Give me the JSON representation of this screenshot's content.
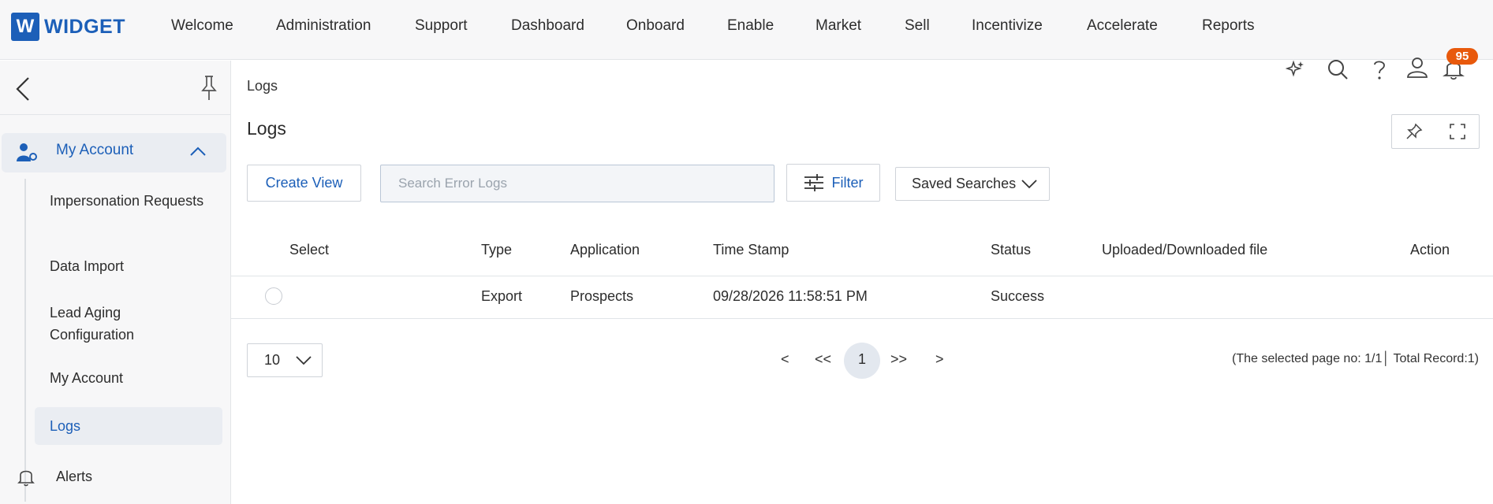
{
  "brand": {
    "logo_letter": "W",
    "name": "WIDGET",
    "color": "#1c5fb8"
  },
  "topnav": [
    "Welcome",
    "Administration",
    "Support",
    "Dashboard",
    "Onboard",
    "Enable",
    "Market",
    "Sell",
    "Incentivize",
    "Accelerate",
    "Reports"
  ],
  "notifications": {
    "count": "95",
    "badge_color": "#e8590c"
  },
  "sidebar": {
    "group_label": "My Account",
    "items": [
      {
        "label": "Impersonation Requests"
      },
      {
        "label": "Data Import"
      },
      {
        "label": "Lead Aging Configuration"
      },
      {
        "label": "My Account"
      },
      {
        "label": "Logs"
      }
    ],
    "alerts_label": "Alerts"
  },
  "breadcrumb": "Logs",
  "page_title": "Logs",
  "toolbar": {
    "create_view": "Create View",
    "search_placeholder": "Search Error Logs",
    "filter": "Filter",
    "saved_searches": "Saved Searches"
  },
  "table": {
    "columns": [
      "Select",
      "Type",
      "Application",
      "Time Stamp",
      "Status",
      "Uploaded/Downloaded file",
      "Action"
    ],
    "rows": [
      {
        "type": "Export",
        "application": "Prospects",
        "timestamp": "09/28/2026 11:58:51 PM",
        "status": "Success",
        "file": "",
        "action": ""
      }
    ]
  },
  "pagination": {
    "page_size": "10",
    "prev": "<",
    "first": "<<",
    "current": "1",
    "last": ">>",
    "next": ">",
    "summary": "(The selected page no: 1/1│ Total Record:1)"
  }
}
